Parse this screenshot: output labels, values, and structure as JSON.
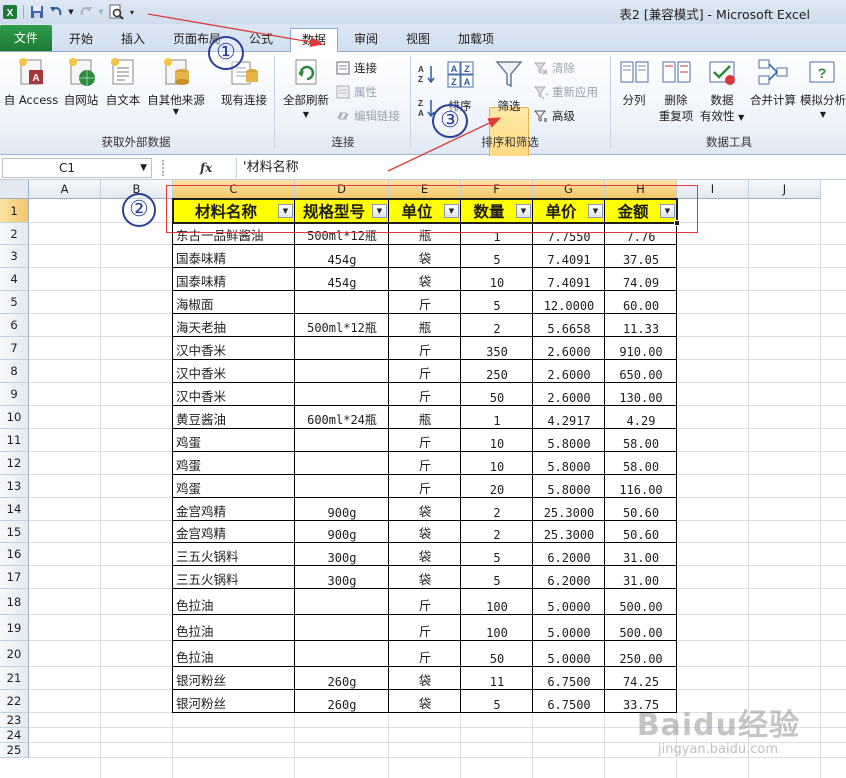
{
  "window": {
    "title": "表2 [兼容模式] - Microsoft Excel"
  },
  "tabs": [
    "文件",
    "开始",
    "插入",
    "页面布局",
    "公式",
    "数据",
    "审阅",
    "视图",
    "加载项"
  ],
  "active_tab": "数据",
  "ribbon": {
    "external": {
      "access": "自 Access",
      "web": "自网站",
      "text": "自文本",
      "other": "自其他来源",
      "existing": "现有连接",
      "group": "获取外部数据"
    },
    "connections": {
      "refresh": "全部刷新",
      "conn": "连接",
      "props": "属性",
      "edit_links": "编辑链接",
      "group": "连接"
    },
    "sort_filter": {
      "sort": "排序",
      "filter": "筛选",
      "clear": "清除",
      "reapply": "重新应用",
      "advanced": "高级",
      "group": "排序和筛选"
    },
    "data_tools": {
      "split": "分列",
      "remove_dup_1": "删除",
      "remove_dup_2": "重复项",
      "validation_1": "数据",
      "validation_2": "有效性",
      "consolidate": "合并计算",
      "whatif": "模拟分析",
      "group": "数据工具"
    }
  },
  "formula_bar": {
    "name_box": "C1",
    "fx": "fx",
    "formula": "'材料名称"
  },
  "columns": [
    "A",
    "B",
    "C",
    "D",
    "E",
    "F",
    "G",
    "H",
    "I",
    "J"
  ],
  "rows": [
    "1",
    "2",
    "3",
    "4",
    "5",
    "6",
    "7",
    "8",
    "9",
    "10",
    "11",
    "12",
    "13",
    "14",
    "15",
    "16",
    "17",
    "18",
    "19",
    "20",
    "21",
    "22",
    "23",
    "24",
    "25"
  ],
  "table": {
    "headers": [
      "材料名称",
      "规格型号",
      "单位",
      "数量",
      "单价",
      "金额"
    ],
    "data": [
      [
        "东古一品鲜酱油",
        "500ml*12瓶",
        "瓶",
        "1",
        "7.7550",
        "7.76"
      ],
      [
        "国泰味精",
        "454g",
        "袋",
        "5",
        "7.4091",
        "37.05"
      ],
      [
        "国泰味精",
        "454g",
        "袋",
        "10",
        "7.4091",
        "74.09"
      ],
      [
        "海椒面",
        "",
        "斤",
        "5",
        "12.0000",
        "60.00"
      ],
      [
        "海天老抽",
        "500ml*12瓶",
        "瓶",
        "2",
        "5.6658",
        "11.33"
      ],
      [
        "汉中香米",
        "",
        "斤",
        "350",
        "2.6000",
        "910.00"
      ],
      [
        "汉中香米",
        "",
        "斤",
        "250",
        "2.6000",
        "650.00"
      ],
      [
        "汉中香米",
        "",
        "斤",
        "50",
        "2.6000",
        "130.00"
      ],
      [
        "黄豆酱油",
        "600ml*24瓶",
        "瓶",
        "1",
        "4.2917",
        "4.29"
      ],
      [
        "鸡蛋",
        "",
        "斤",
        "10",
        "5.8000",
        "58.00"
      ],
      [
        "鸡蛋",
        "",
        "斤",
        "10",
        "5.8000",
        "58.00"
      ],
      [
        "鸡蛋",
        "",
        "斤",
        "20",
        "5.8000",
        "116.00"
      ],
      [
        "金宫鸡精",
        "900g",
        "袋",
        "2",
        "25.3000",
        "50.60"
      ],
      [
        "金宫鸡精",
        "900g",
        "袋",
        "2",
        "25.3000",
        "50.60"
      ],
      [
        "三五火锅料",
        "300g",
        "袋",
        "5",
        "6.2000",
        "31.00"
      ],
      [
        "三五火锅料",
        "300g",
        "袋",
        "5",
        "6.2000",
        "31.00"
      ],
      [
        "色拉油",
        "",
        "斤",
        "100",
        "5.0000",
        "500.00"
      ],
      [
        "色拉油",
        "",
        "斤",
        "100",
        "5.0000",
        "500.00"
      ],
      [
        "色拉油",
        "",
        "斤",
        "50",
        "5.0000",
        "250.00"
      ],
      [
        "银河粉丝",
        "260g",
        "袋",
        "11",
        "6.7500",
        "74.25"
      ],
      [
        "银河粉丝",
        "260g",
        "袋",
        "5",
        "6.7500",
        "33.75"
      ]
    ]
  },
  "annotations": [
    "①",
    "②",
    "③"
  ],
  "watermark": {
    "brand": "Baidu经验",
    "url": "jingyan.baidu.com"
  },
  "colors": {
    "header_fill": "#ffff00",
    "file_tab": "#1f7a37",
    "annotation_blue": "#2a3f9a",
    "arrow_red": "#e03a3a"
  }
}
